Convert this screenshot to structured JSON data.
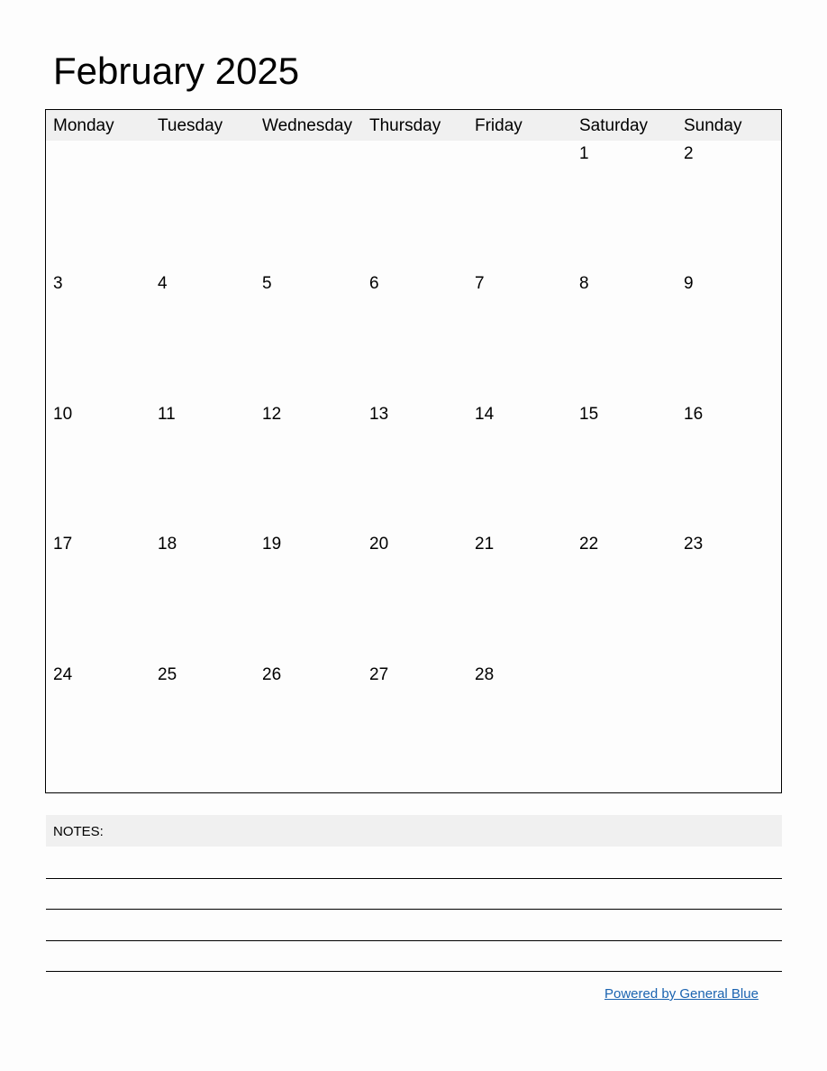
{
  "title": "February 2025",
  "weekdays": [
    "Monday",
    "Tuesday",
    "Wednesday",
    "Thursday",
    "Friday",
    "Saturday",
    "Sunday"
  ],
  "weeks": [
    [
      "",
      "",
      "",
      "",
      "",
      "1",
      "2"
    ],
    [
      "3",
      "4",
      "5",
      "6",
      "7",
      "8",
      "9"
    ],
    [
      "10",
      "11",
      "12",
      "13",
      "14",
      "15",
      "16"
    ],
    [
      "17",
      "18",
      "19",
      "20",
      "21",
      "22",
      "23"
    ],
    [
      "24",
      "25",
      "26",
      "27",
      "28",
      "",
      ""
    ]
  ],
  "notes": {
    "label": "NOTES:",
    "line_count": 4
  },
  "footer": {
    "link_text": "Powered by General Blue",
    "link_color": "#1a63b0"
  },
  "colors": {
    "header_bg": "#f0f0f0",
    "border": "#000000"
  }
}
